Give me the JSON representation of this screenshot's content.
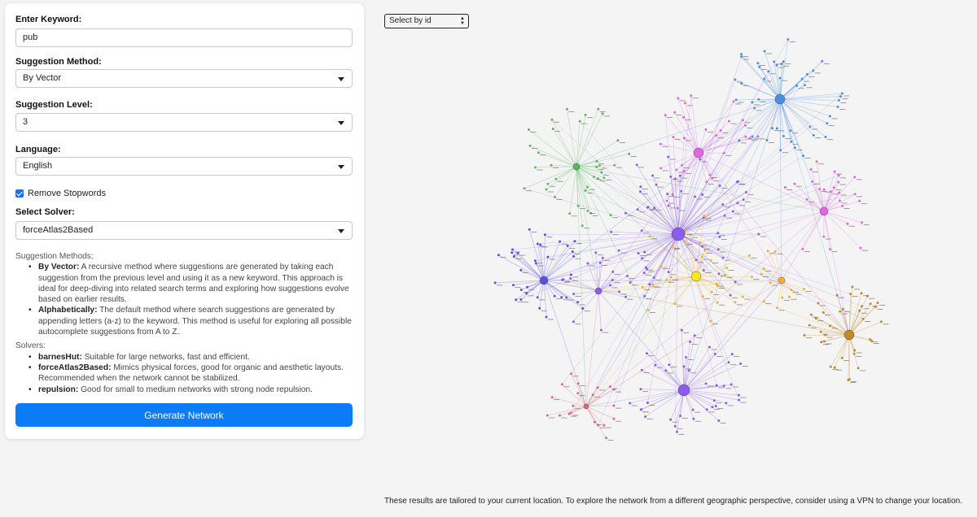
{
  "form": {
    "keyword_label": "Enter Keyword:",
    "keyword_value": "pub",
    "method_label": "Suggestion Method:",
    "method_value": "By Vector",
    "level_label": "Suggestion Level:",
    "level_value": "3",
    "language_label": "Language:",
    "language_value": "English",
    "stopwords_label": "Remove Stopwords",
    "stopwords_checked": true,
    "solver_label": "Select Solver:",
    "solver_value": "forceAtlas2Based"
  },
  "info": {
    "methods_title": "Suggestion Methods:",
    "methods": [
      {
        "name": "By Vector:",
        "desc": "A recursive method where suggestions are generated by taking each suggestion from the previous level and using it as a new keyword. This approach is ideal for deep-diving into related search terms and exploring how suggestions evolve based on earlier results."
      },
      {
        "name": "Alphabetically:",
        "desc": "The default method where search suggestions are generated by appending letters (a-z) to the keyword. This method is useful for exploring all possible autocomplete suggestions from A to Z."
      }
    ],
    "solvers_title": "Solvers:",
    "solvers": [
      {
        "name": "barnesHut:",
        "desc": "Suitable for large networks, fast and efficient."
      },
      {
        "name": "forceAtlas2Based:",
        "desc": "Mimics physical forces, good for organic and aesthetic layouts. Recommended when the network cannot be stabilized."
      },
      {
        "name": "repulsion:",
        "desc": "Good for small to medium networks with strong node repulsion."
      }
    ]
  },
  "generate_button": "Generate Network",
  "select_by_id": "Select by id",
  "footer": "These results are tailored to your current location. To explore the network from a different geographic perspective, consider using a VPN to change your location.",
  "colors": {
    "accent": "#0b7cf5",
    "clusters": [
      "#8a5cf0",
      "#4a90e2",
      "#5cb85c",
      "#e066e6",
      "#f0b030",
      "#c08a2a",
      "#e06a7a",
      "#5a50e0"
    ]
  }
}
